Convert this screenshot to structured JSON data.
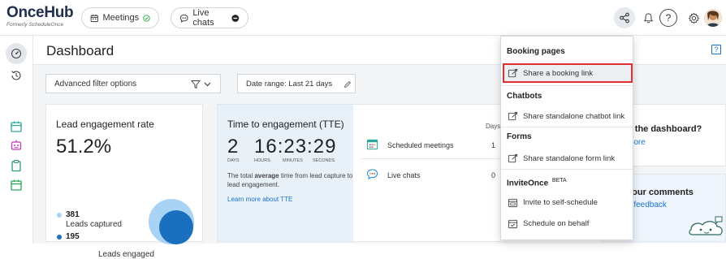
{
  "header": {
    "logo": "OnceHub",
    "logo_sub": "Formerly ScheduleOnce",
    "meetings": "Meetings",
    "live_chats": "Live chats",
    "help": "?"
  },
  "dashboard": {
    "title": "Dashboard",
    "help": "?",
    "filter_label": "Advanced filter options",
    "date_range": "Date range: Last 21 days"
  },
  "lead_engagement": {
    "title": "Lead engagement rate",
    "rate": "51.2%",
    "captured_count": "381",
    "captured_label": "Leads captured",
    "engaged_count": "195",
    "engaged_label": "Leads engaged"
  },
  "tte": {
    "title": "Time to engagement (TTE)",
    "days": "2",
    "time": "16:23:29",
    "units": {
      "days": "DAYS",
      "hours": "HOURS",
      "minutes": "MINUTES",
      "seconds": "SECONDS"
    },
    "desc_pre": "The total ",
    "desc_bold": "average",
    "desc_post": " time from lead capture to lead engagement.",
    "learn_more": "Learn more about TTE"
  },
  "channels": {
    "col_header": "Days",
    "rows": [
      {
        "label": "Scheduled meetings",
        "value": "1"
      },
      {
        "label": "Live chats",
        "value": "0"
      }
    ]
  },
  "promo": {
    "text1": "o the dashboard?",
    "text2": "more",
    "text3": "your comments",
    "text4": "e feedback"
  },
  "share_menu": {
    "booking_header": "Booking pages",
    "share_booking": "Share a booking link",
    "chatbots_header": "Chatbots",
    "share_chatbot": "Share standalone chatbot link",
    "forms_header": "Forms",
    "share_form": "Share standalone form link",
    "invite_header": "InviteOnce",
    "invite_badge": "BETA",
    "invite_self": "Invite to self-schedule",
    "schedule_behalf": "Schedule on behalf"
  },
  "colors": {
    "accent": "#1a73c9",
    "highlight_border": "#e0302f",
    "chart_light": "#a8d3f5",
    "chart_dark": "#1a6fbf",
    "green_check": "#2eaa4a",
    "sidebar_icons": "#2aa89a"
  }
}
